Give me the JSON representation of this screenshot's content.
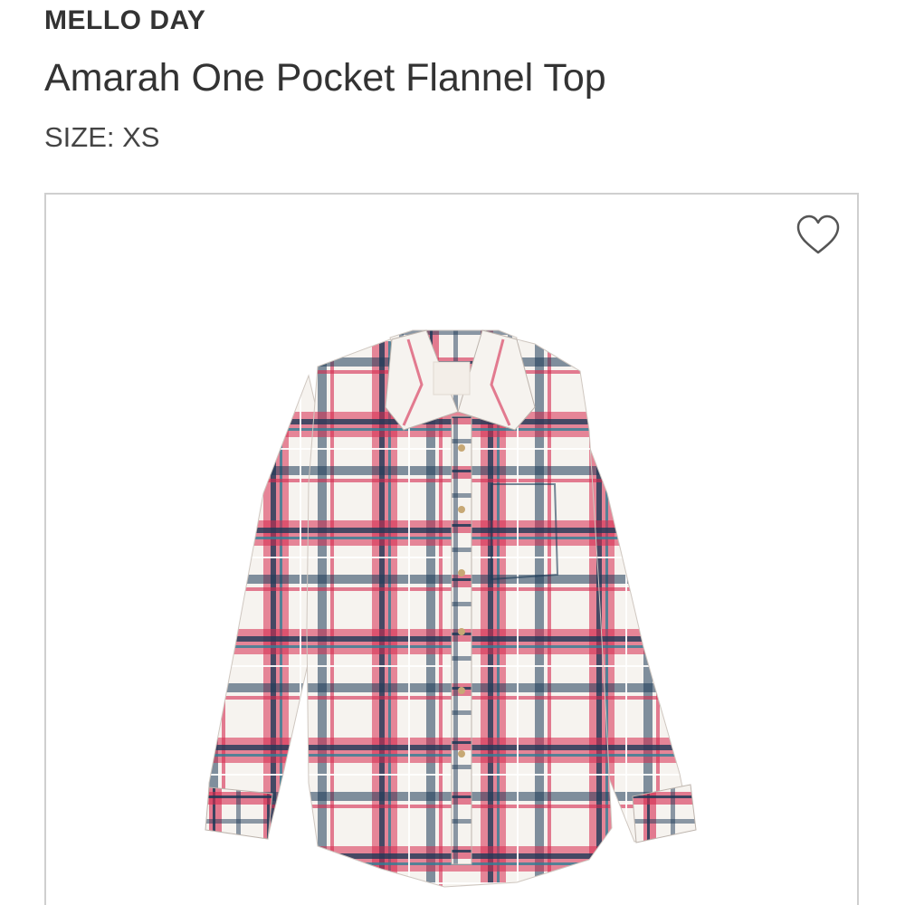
{
  "product": {
    "brand": "MELLO DAY",
    "name": "Amarah One Pocket Flannel Top",
    "size_label": "SIZE: XS"
  },
  "image": {
    "icon": "heart-outline-icon",
    "colors": {
      "red": "#d6294f",
      "navy": "#1d3a57",
      "teal": "#2f7f96",
      "white": "#f6f3ef",
      "button": "#c7a875"
    }
  }
}
